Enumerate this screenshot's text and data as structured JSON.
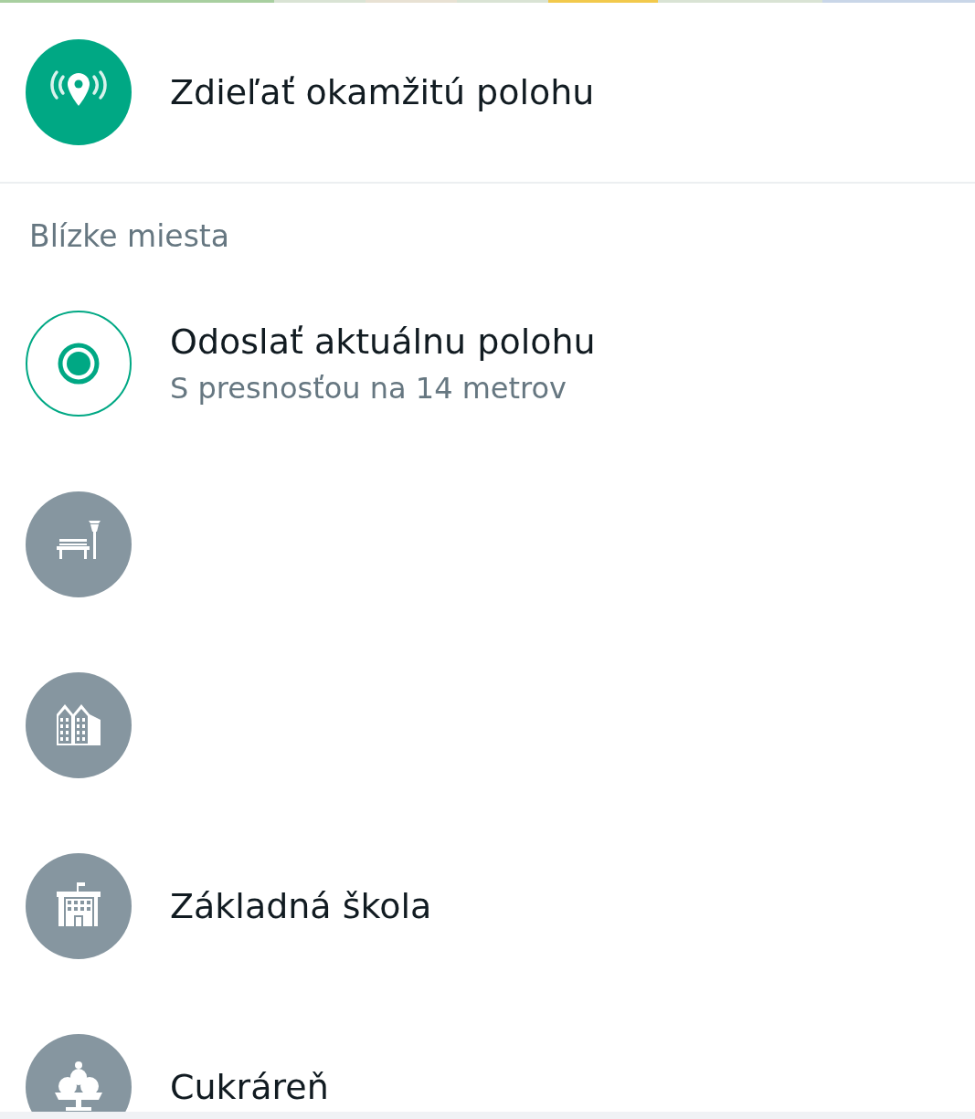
{
  "share_live": {
    "label": "Zdieľať okamžitú polohu"
  },
  "section_title": "Blízke miesta",
  "places": [
    {
      "kind": "current",
      "title": "Odoslať aktuálnu polohu",
      "subtitle": "S presnosťou na 14 metrov"
    },
    {
      "kind": "place"
    },
    {
      "kind": "place"
    },
    {
      "kind": "place",
      "title": "Základná škola"
    },
    {
      "kind": "place",
      "title": "Cukráreň"
    }
  ]
}
